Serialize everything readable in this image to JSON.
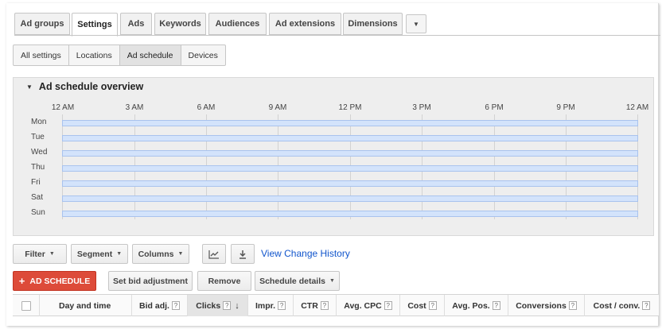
{
  "tabs": [
    {
      "label": "Ad groups",
      "active": false
    },
    {
      "label": "Settings",
      "active": true
    },
    {
      "label": "Ads",
      "active": false
    },
    {
      "label": "Keywords",
      "active": false
    },
    {
      "label": "Audiences",
      "active": false
    },
    {
      "label": "Ad extensions",
      "active": false
    },
    {
      "label": "Dimensions",
      "active": false
    }
  ],
  "tabs_more_icon": "caret-down-icon",
  "subtabs": [
    {
      "label": "All settings",
      "active": false
    },
    {
      "label": "Locations",
      "active": false
    },
    {
      "label": "Ad schedule",
      "active": true
    },
    {
      "label": "Devices",
      "active": false
    }
  ],
  "overview": {
    "title": "Ad schedule overview",
    "hours": [
      "12 AM",
      "3 AM",
      "6 AM",
      "9 AM",
      "12 PM",
      "3 PM",
      "6 PM",
      "9 PM",
      "12 AM"
    ],
    "days": [
      "Mon",
      "Tue",
      "Wed",
      "Thu",
      "Fri",
      "Sat",
      "Sun"
    ]
  },
  "toolbar": {
    "filter": "Filter",
    "segment": "Segment",
    "columns": "Columns",
    "chart_icon": "line-chart-icon",
    "download_icon": "download-icon",
    "history_link": "View Change History"
  },
  "actions": {
    "add_schedule": "AD SCHEDULE",
    "add_icon": "plus-icon",
    "set_bid": "Set bid adjustment",
    "remove": "Remove",
    "schedule_details": "Schedule details"
  },
  "table": {
    "columns": [
      {
        "label": "Day and time",
        "help": false
      },
      {
        "label": "Bid adj.",
        "help": true
      },
      {
        "label": "Clicks",
        "help": true,
        "sorted": true
      },
      {
        "label": "Impr.",
        "help": true
      },
      {
        "label": "CTR",
        "help": true
      },
      {
        "label": "Avg. CPC",
        "help": true
      },
      {
        "label": "Cost",
        "help": true
      },
      {
        "label": "Avg. Pos.",
        "help": true
      },
      {
        "label": "Conversions",
        "help": true
      },
      {
        "label": "Cost / conv.",
        "help": true
      }
    ],
    "help_glyph": "?",
    "sort_icon": "arrow-down-icon"
  },
  "colors": {
    "accent_red": "#dd4b39",
    "link_blue": "#1155cc",
    "bar_fill": "#d3e3fb",
    "bar_border": "#a9c3ee"
  }
}
